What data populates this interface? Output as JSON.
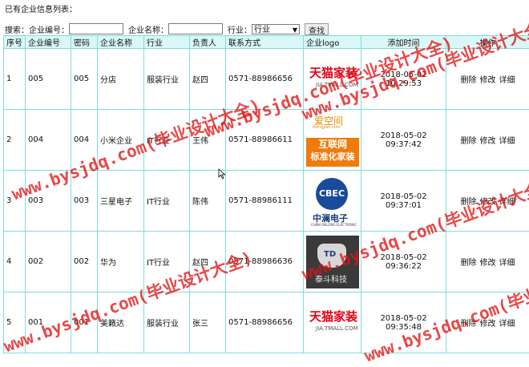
{
  "page": {
    "title": "已有企业信息列表："
  },
  "search": {
    "label": "搜索：",
    "code_label": "企业编号：",
    "name_label": "企业名称：",
    "industry_label": "行业：",
    "industry_value": "行业",
    "button": "查找"
  },
  "table": {
    "headers": [
      "序号",
      "企业编号",
      "密码",
      "企业名称",
      "行业",
      "负责人",
      "联系方式",
      "企业logo",
      "添加时间",
      "操作"
    ],
    "rows": [
      {
        "idx": "1",
        "code": "005",
        "pwd": "005",
        "name": "分店",
        "industry": "服装行业",
        "owner": "赵四",
        "phone": "0571-88986656",
        "logo": "tmall-logo",
        "date": "2018-05-02",
        "time": "10:29:53"
      },
      {
        "idx": "2",
        "code": "004",
        "pwd": "004",
        "name": "小米企业",
        "industry": "IT行业",
        "owner": "王伟",
        "phone": "0571-88986611",
        "logo": "aikongjian-logo",
        "date": "2018-05-02",
        "time": "09:37:42"
      },
      {
        "idx": "3",
        "code": "003",
        "pwd": "003",
        "name": "三星电子",
        "industry": "IT行业",
        "owner": "陈伟",
        "phone": "0571-88986111",
        "logo": "cbec-logo",
        "date": "2018-05-02",
        "time": "09:37:01"
      },
      {
        "idx": "4",
        "code": "002",
        "pwd": "002",
        "name": "华为",
        "industry": "IT行业",
        "owner": "赵四",
        "phone": "0571-88986636",
        "logo": "td-logo",
        "date": "2018-05-02",
        "time": "09:36:22"
      },
      {
        "idx": "5",
        "code": "001",
        "pwd": "001",
        "name": "美籁达",
        "industry": "服装行业",
        "owner": "张三",
        "phone": "0571-88986656",
        "logo": "tmall-logo",
        "date": "2018-05-02",
        "time": "09:35:48"
      }
    ],
    "ops": {
      "delete": "删除",
      "edit": "修改",
      "detail": "详细"
    }
  },
  "logos": {
    "tmall": {
      "main": "天猫家装",
      "sub": "JIA.TMALL.COM"
    },
    "aikongjian": {
      "top": "爱空间",
      "sub": "ikongjian.com",
      "line1": "互联网",
      "line2": "标准化家装"
    },
    "cbec": {
      "circle": "CBEC",
      "cn": "中澜电子",
      "en": "CHINA BELONG ELECTRONIC"
    },
    "td": {
      "mark": "TD",
      "text": "泰斗科技"
    }
  },
  "watermark": {
    "text": "www.bysjdq.com(毕业设计大全)"
  },
  "colors": {
    "header_bg": "#d9f7f7",
    "border": "#7fdcdc",
    "watermark": "#e11414"
  }
}
